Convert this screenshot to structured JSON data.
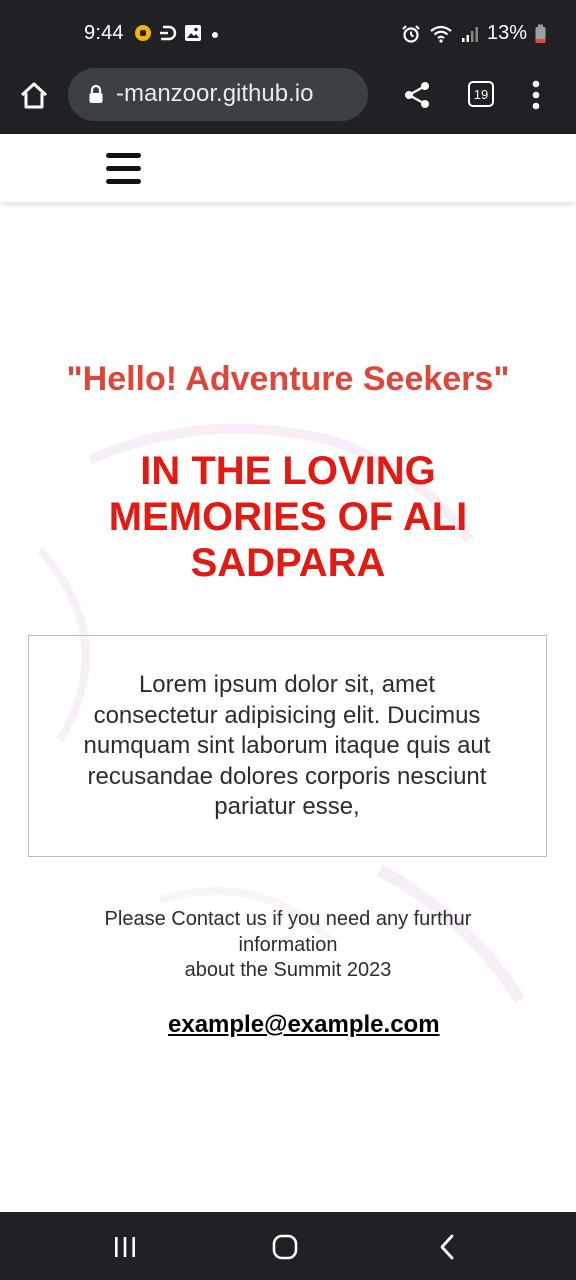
{
  "status_bar": {
    "time": "9:44",
    "battery": "13%",
    "left_icons": [
      "coin-icon",
      "d-app-icon",
      "gallery-icon",
      "dot-icon"
    ],
    "right_icons": [
      "alarm-icon",
      "wifi-icon",
      "signal-icon",
      "battery-icon"
    ]
  },
  "browser": {
    "url": "-manzoor.github.io",
    "tab_count": "19",
    "icons": [
      "home-icon",
      "lock-icon",
      "share-icon",
      "tabs-icon",
      "more-vert-icon"
    ]
  },
  "site": {
    "tagline": "\"Hello! Adventure Seekers\"",
    "headline": "IN THE LOVING MEMORIES OF ALI SADPARA",
    "lorem": "Lorem ipsum dolor sit, amet consectetur adipisicing elit. Ducimus numquam sint laborum itaque quis aut recusandae dolores corporis nesciunt pariatur esse,",
    "contact_line1": "Please Contact us if you need any furthur information",
    "contact_line2": "about the Summit 2023",
    "email": "example@example.com"
  },
  "colors": {
    "tagline": "#e0453a",
    "headline": "#e21a11",
    "chrome_bg": "#202124"
  }
}
